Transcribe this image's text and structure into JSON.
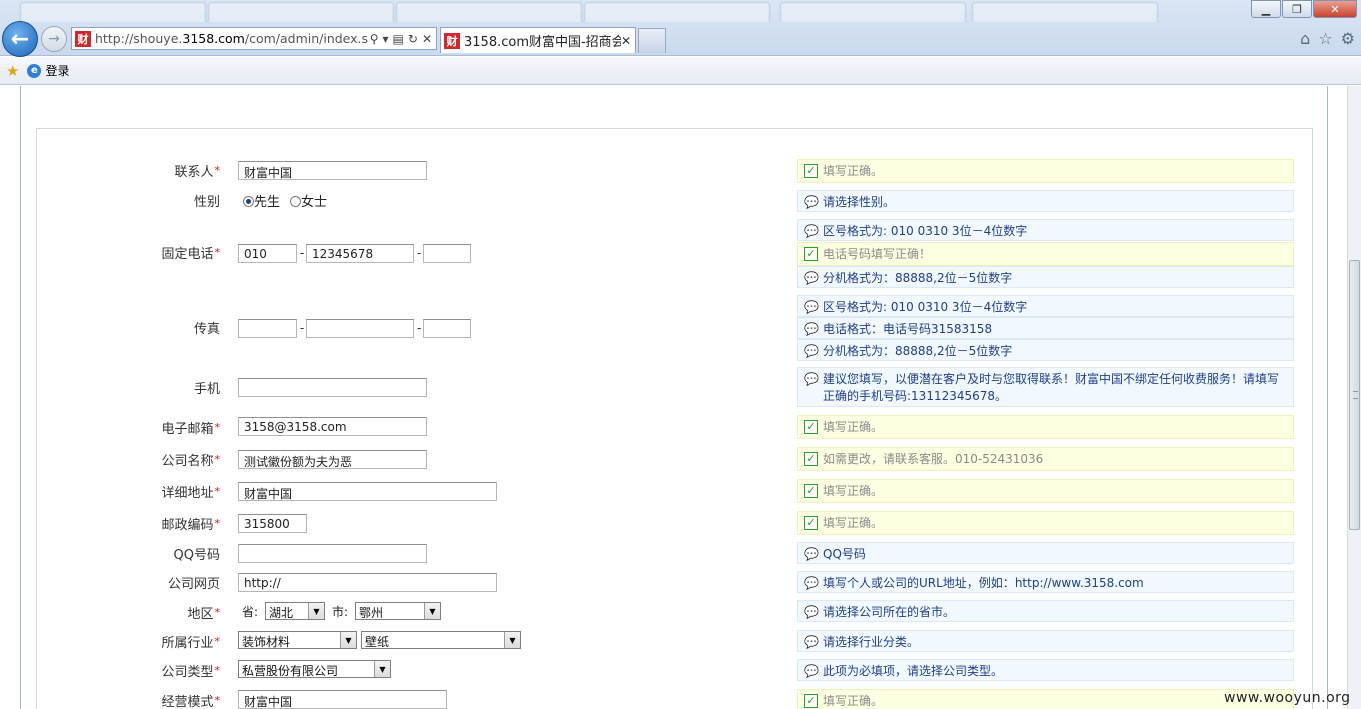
{
  "browser": {
    "address_url": "http://shouye.3158.com/com/admin/index.s",
    "address_prefix": "http://shouye.",
    "address_domain": "3158.com",
    "address_path": "/com/admin/index.s",
    "favicon_char": "财",
    "active_tab_title": "3158.com财富中国-招商会...",
    "favorites_item": "登录"
  },
  "form": {
    "contact": {
      "label": "联系人",
      "value": "财富中国"
    },
    "gender": {
      "label": "性别",
      "options": [
        "先生",
        "女士"
      ],
      "selected": "先生"
    },
    "phone": {
      "label": "固定电话",
      "area": "010",
      "number": "12345678",
      "ext": ""
    },
    "fax": {
      "label": "传真",
      "area": "",
      "number": "",
      "ext": ""
    },
    "mobile": {
      "label": "手机",
      "value": ""
    },
    "email": {
      "label": "电子邮箱",
      "value": "3158@3158.com"
    },
    "company_name": {
      "label": "公司名称",
      "value": "测试徽份额为夫为恶"
    },
    "address": {
      "label": "详细地址",
      "value": "财富中国"
    },
    "postcode": {
      "label": "邮政编码",
      "value": "315800"
    },
    "qq": {
      "label": "QQ号码",
      "value": ""
    },
    "website": {
      "label": "公司网页",
      "value": "http://"
    },
    "region": {
      "label": "地区",
      "province_label": "省:",
      "province": "湖北",
      "city_label": "市:",
      "city": "鄂州"
    },
    "industry": {
      "label": "所属行业",
      "primary": "装饰材料",
      "secondary": "壁纸"
    },
    "company_type": {
      "label": "公司类型",
      "value": "私营股份有限公司"
    },
    "business_model": {
      "label": "经营模式",
      "value": "财富中国"
    }
  },
  "tips": {
    "contact": "填写正确。",
    "gender": "请选择性别。",
    "phone_area": "区号格式为:  010 0310 3位－4位数字",
    "phone_number": "电话号码填写正确！",
    "phone_ext": "分机格式为：88888,2位－5位数字",
    "fax_area": "区号格式为:  010 0310 3位－4位数字",
    "fax_number": "电话格式：电话号码31583158",
    "fax_ext": "分机格式为：88888,2位－5位数字",
    "mobile": "建议您填写，以便潜在客户及时与您取得联系！财富中国不绑定任何收费服务！请填写正确的手机号码:13112345678。",
    "email": "填写正确。",
    "company_name": "如需更改，请联系客服。010-52431036",
    "address": "填写正确。",
    "postcode": "填写正确。",
    "qq": "QQ号码",
    "website": "填写个人或公司的URL地址，例如：",
    "website_example": "http://www.3158.com",
    "region": "请选择公司所在的省市。",
    "industry": "请选择行业分类。",
    "company_type": "此项为必填项，请选择公司类型。",
    "business_model": "填写正确。"
  },
  "watermark": "www.wooyun.org",
  "colors": {
    "required": "#e0121a",
    "ok_bg": "#ffffe2",
    "info_bg": "#f1f8ff",
    "ok_icon": "#2b9c24",
    "info_icon": "#d89416"
  }
}
